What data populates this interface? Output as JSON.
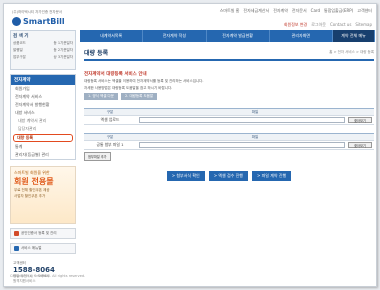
{
  "top_nav": [
    "스마트빌 홈",
    "전자세금계산서",
    "전자계약",
    "전자문서",
    "Card",
    "통합입출금(ERP)",
    "고객센터"
  ],
  "top_links": [
    "회원정보 변경",
    "로그아웃",
    "Contact us",
    "Sitemap"
  ],
  "logo": {
    "slogan": "(주)하이텍시티 자가인증 전자문서",
    "text": "SmartBill"
  },
  "menu": [
    "내계약서목록",
    "전자계약 작성",
    "전자계약 발급현황",
    "관리자화면",
    "계약 전체 메뉴"
  ],
  "search": {
    "title": "검 색 기",
    "rows": [
      [
        "상품코드",
        "등 1기준일자"
      ],
      [
        "발행일",
        "등 2기준일자"
      ],
      [
        "업무구분",
        "상 3기준일자"
      ]
    ]
  },
  "sidebar": {
    "title": "전자계약",
    "items": [
      "회원가입",
      "전자계약 서비스",
      "전자계약서 발행현황",
      "내방 서비스",
      "내방 계약서 관리",
      "담당자관리",
      "대량 등록",
      "통계",
      "관리자(등급별) 관리"
    ],
    "active_index": 6
  },
  "promo": {
    "line1": "스마트빌 회원을 위한",
    "line2": "회원 전용몰",
    "line3": "무료 전체 할인쿠폰 제공",
    "line4": "사업자 할인쿠폰 추가"
  },
  "side_buttons": [
    "공인인증서 등록 및 관리",
    "서비스 매뉴얼"
  ],
  "cs": {
    "label": "고객센터",
    "phone": "1588-8064",
    "hours": "평일 오전9시 ~ 오후6시",
    "extra": "원격지원서비스"
  },
  "page": {
    "title": "대량 등록",
    "breadcrumb": "홈 > 전자 서비스 > 대량 등록"
  },
  "section": {
    "title": "전자계약서 대량등록 서비스 안내",
    "desc1": "대량등록 서비스는 엑셀을 이용하여 전자계약서를 등록 및 관리하는 서비스입니다.",
    "desc2": "자세한 사용방법은 대량등록 도움말을 참고 하시기 바랍니다."
  },
  "tabs": [
    "1. 양식 엑셀 다운",
    "2. 대량등록 도움말"
  ],
  "table1": {
    "col1": "구분",
    "col2": "파일",
    "row_label": "엑셀 업로드",
    "btn": "찾아보기"
  },
  "table2": {
    "col1": "구분",
    "col2": "파일",
    "row_label": "공통 첨부 파일 1",
    "btn": "찾아보기",
    "add": "첨부파일 추가"
  },
  "actions": [
    "> 첨부서식 확인",
    "> 엑셀 검수 진행",
    "> 파일 계약 진행"
  ],
  "footer": "Copyright (c) SmartBill. All rights reserved."
}
